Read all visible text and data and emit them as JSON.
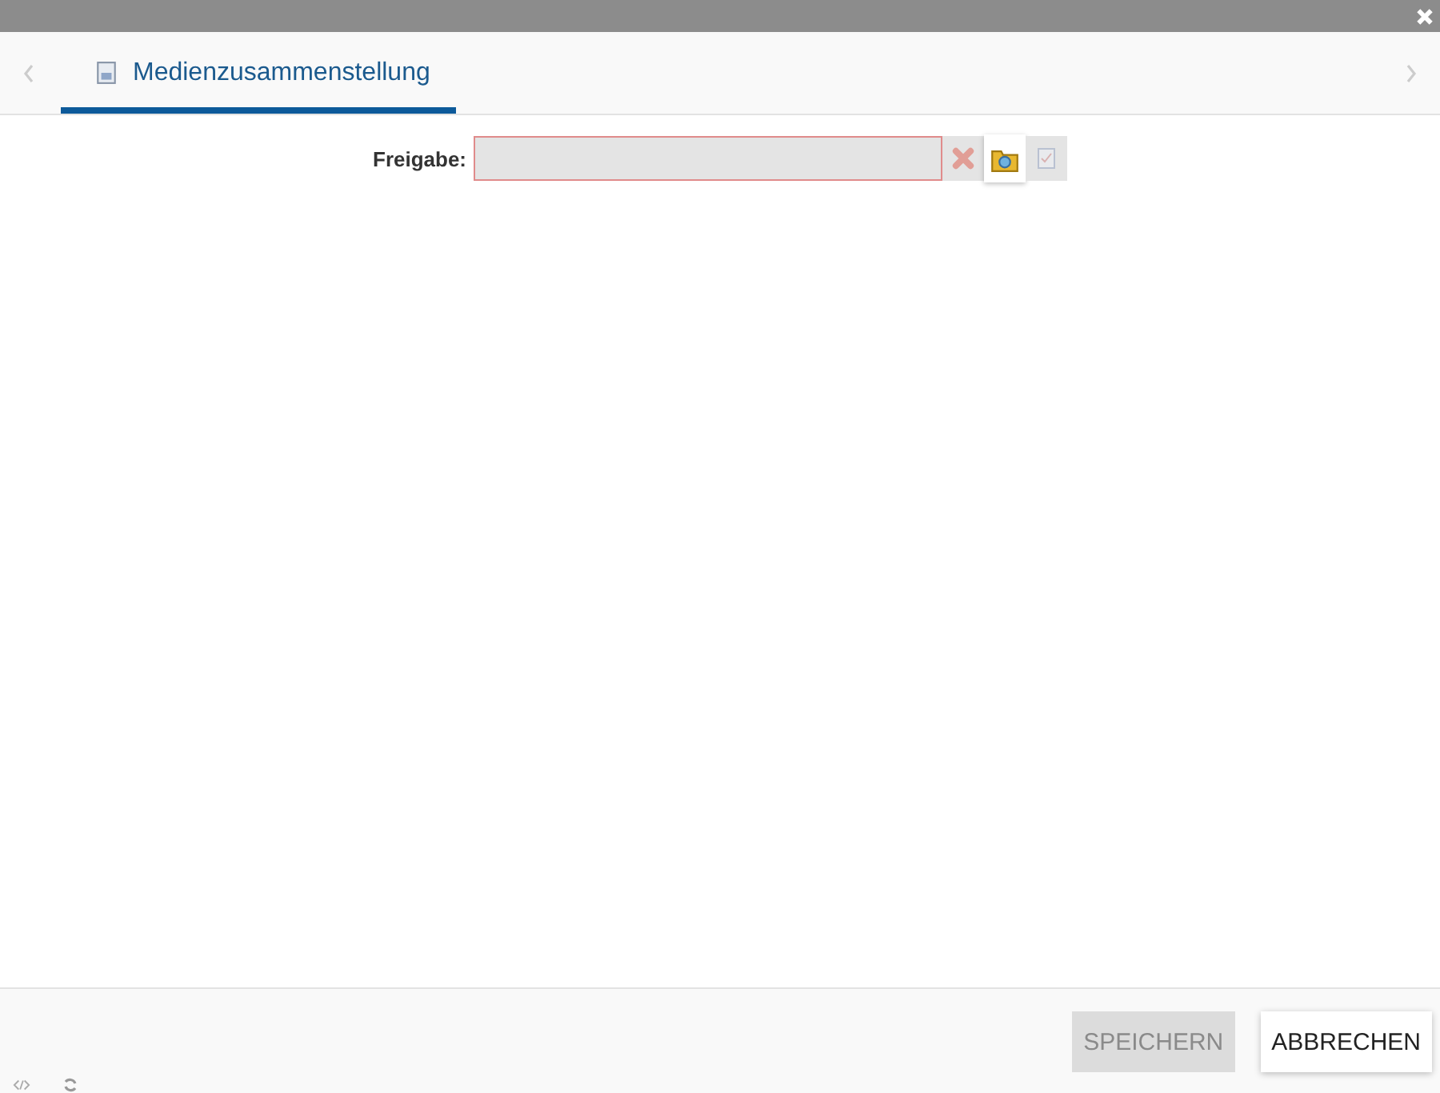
{
  "tabs": [
    {
      "label": "Medienzusammenstellung",
      "selected": true
    }
  ],
  "form": {
    "label": "Freigabe:",
    "invalid": true,
    "actions": [
      {
        "kind": "clear",
        "disabled": true
      },
      {
        "kind": "browse",
        "disabled": false
      },
      {
        "kind": "check",
        "disabled": true
      }
    ]
  },
  "buttons": [
    {
      "label": "SPEICHERN",
      "disabled": true
    },
    {
      "label": "ABBRECHEN",
      "disabled": false
    }
  ]
}
